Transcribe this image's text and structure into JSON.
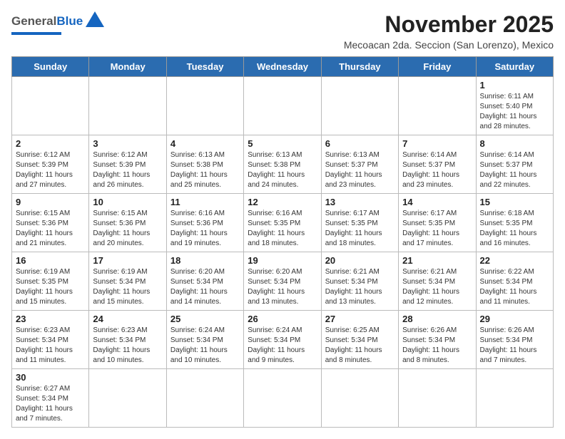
{
  "header": {
    "logo_general": "General",
    "logo_blue": "Blue",
    "month_title": "November 2025",
    "subtitle": "Mecoacan 2da. Seccion (San Lorenzo), Mexico"
  },
  "days_of_week": [
    "Sunday",
    "Monday",
    "Tuesday",
    "Wednesday",
    "Thursday",
    "Friday",
    "Saturday"
  ],
  "weeks": [
    {
      "days": [
        {
          "num": "",
          "info": ""
        },
        {
          "num": "",
          "info": ""
        },
        {
          "num": "",
          "info": ""
        },
        {
          "num": "",
          "info": ""
        },
        {
          "num": "",
          "info": ""
        },
        {
          "num": "",
          "info": ""
        },
        {
          "num": "1",
          "info": "Sunrise: 6:11 AM\nSunset: 5:40 PM\nDaylight: 11 hours\nand 28 minutes."
        }
      ]
    },
    {
      "days": [
        {
          "num": "2",
          "info": "Sunrise: 6:12 AM\nSunset: 5:39 PM\nDaylight: 11 hours\nand 27 minutes."
        },
        {
          "num": "3",
          "info": "Sunrise: 6:12 AM\nSunset: 5:39 PM\nDaylight: 11 hours\nand 26 minutes."
        },
        {
          "num": "4",
          "info": "Sunrise: 6:13 AM\nSunset: 5:38 PM\nDaylight: 11 hours\nand 25 minutes."
        },
        {
          "num": "5",
          "info": "Sunrise: 6:13 AM\nSunset: 5:38 PM\nDaylight: 11 hours\nand 24 minutes."
        },
        {
          "num": "6",
          "info": "Sunrise: 6:13 AM\nSunset: 5:37 PM\nDaylight: 11 hours\nand 23 minutes."
        },
        {
          "num": "7",
          "info": "Sunrise: 6:14 AM\nSunset: 5:37 PM\nDaylight: 11 hours\nand 23 minutes."
        },
        {
          "num": "8",
          "info": "Sunrise: 6:14 AM\nSunset: 5:37 PM\nDaylight: 11 hours\nand 22 minutes."
        }
      ]
    },
    {
      "days": [
        {
          "num": "9",
          "info": "Sunrise: 6:15 AM\nSunset: 5:36 PM\nDaylight: 11 hours\nand 21 minutes."
        },
        {
          "num": "10",
          "info": "Sunrise: 6:15 AM\nSunset: 5:36 PM\nDaylight: 11 hours\nand 20 minutes."
        },
        {
          "num": "11",
          "info": "Sunrise: 6:16 AM\nSunset: 5:36 PM\nDaylight: 11 hours\nand 19 minutes."
        },
        {
          "num": "12",
          "info": "Sunrise: 6:16 AM\nSunset: 5:35 PM\nDaylight: 11 hours\nand 18 minutes."
        },
        {
          "num": "13",
          "info": "Sunrise: 6:17 AM\nSunset: 5:35 PM\nDaylight: 11 hours\nand 18 minutes."
        },
        {
          "num": "14",
          "info": "Sunrise: 6:17 AM\nSunset: 5:35 PM\nDaylight: 11 hours\nand 17 minutes."
        },
        {
          "num": "15",
          "info": "Sunrise: 6:18 AM\nSunset: 5:35 PM\nDaylight: 11 hours\nand 16 minutes."
        }
      ]
    },
    {
      "days": [
        {
          "num": "16",
          "info": "Sunrise: 6:19 AM\nSunset: 5:35 PM\nDaylight: 11 hours\nand 15 minutes."
        },
        {
          "num": "17",
          "info": "Sunrise: 6:19 AM\nSunset: 5:34 PM\nDaylight: 11 hours\nand 15 minutes."
        },
        {
          "num": "18",
          "info": "Sunrise: 6:20 AM\nSunset: 5:34 PM\nDaylight: 11 hours\nand 14 minutes."
        },
        {
          "num": "19",
          "info": "Sunrise: 6:20 AM\nSunset: 5:34 PM\nDaylight: 11 hours\nand 13 minutes."
        },
        {
          "num": "20",
          "info": "Sunrise: 6:21 AM\nSunset: 5:34 PM\nDaylight: 11 hours\nand 13 minutes."
        },
        {
          "num": "21",
          "info": "Sunrise: 6:21 AM\nSunset: 5:34 PM\nDaylight: 11 hours\nand 12 minutes."
        },
        {
          "num": "22",
          "info": "Sunrise: 6:22 AM\nSunset: 5:34 PM\nDaylight: 11 hours\nand 11 minutes."
        }
      ]
    },
    {
      "days": [
        {
          "num": "23",
          "info": "Sunrise: 6:23 AM\nSunset: 5:34 PM\nDaylight: 11 hours\nand 11 minutes."
        },
        {
          "num": "24",
          "info": "Sunrise: 6:23 AM\nSunset: 5:34 PM\nDaylight: 11 hours\nand 10 minutes."
        },
        {
          "num": "25",
          "info": "Sunrise: 6:24 AM\nSunset: 5:34 PM\nDaylight: 11 hours\nand 10 minutes."
        },
        {
          "num": "26",
          "info": "Sunrise: 6:24 AM\nSunset: 5:34 PM\nDaylight: 11 hours\nand 9 minutes."
        },
        {
          "num": "27",
          "info": "Sunrise: 6:25 AM\nSunset: 5:34 PM\nDaylight: 11 hours\nand 8 minutes."
        },
        {
          "num": "28",
          "info": "Sunrise: 6:26 AM\nSunset: 5:34 PM\nDaylight: 11 hours\nand 8 minutes."
        },
        {
          "num": "29",
          "info": "Sunrise: 6:26 AM\nSunset: 5:34 PM\nDaylight: 11 hours\nand 7 minutes."
        }
      ]
    },
    {
      "days": [
        {
          "num": "30",
          "info": "Sunrise: 6:27 AM\nSunset: 5:34 PM\nDaylight: 11 hours\nand 7 minutes."
        },
        {
          "num": "",
          "info": ""
        },
        {
          "num": "",
          "info": ""
        },
        {
          "num": "",
          "info": ""
        },
        {
          "num": "",
          "info": ""
        },
        {
          "num": "",
          "info": ""
        },
        {
          "num": "",
          "info": ""
        }
      ]
    }
  ]
}
